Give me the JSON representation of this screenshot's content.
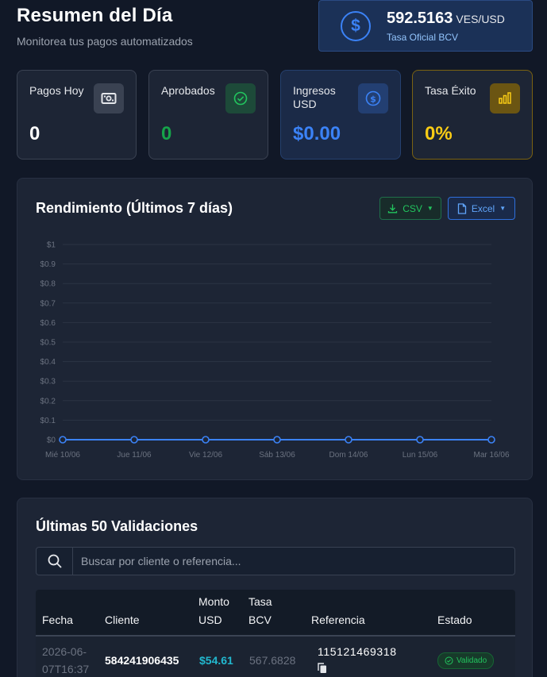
{
  "header": {
    "title": "Resumen del Día",
    "subtitle": "Monitorea tus pagos automatizados"
  },
  "exchange_rate": {
    "value": "592.5163",
    "unit": "VES/USD",
    "label": "Tasa Oficial BCV",
    "icon": "dollar-circle-icon"
  },
  "stats": [
    {
      "label": "Pagos Hoy",
      "value": "0",
      "icon": "money-icon",
      "color": "#ffffff",
      "accent": "#3a4252"
    },
    {
      "label": "Aprobados",
      "value": "0",
      "icon": "check-circle-icon",
      "color": "#16a34a",
      "accent": "#1f6a44"
    },
    {
      "label": "Ingresos USD",
      "value": "$0.00",
      "icon": "dollar-circle-icon",
      "color": "#3b82f6",
      "accent": "#1e3a8a"
    },
    {
      "label": "Tasa Éxito",
      "value": "0%",
      "icon": "bar-chart-icon",
      "color": "#facc15",
      "accent": "#7a6212"
    }
  ],
  "performance": {
    "title": "Rendimiento (Últimos 7 días)",
    "csv_label": "CSV",
    "excel_label": "Excel"
  },
  "chart_data": {
    "type": "line",
    "categories": [
      "Mié 10/06",
      "Jue 11/06",
      "Vie 12/06",
      "Sáb 13/06",
      "Dom 14/06",
      "Lun 15/06",
      "Mar 16/06"
    ],
    "series": [
      {
        "values": [
          0,
          0,
          0,
          0,
          0,
          0,
          0
        ]
      }
    ],
    "y_ticks": [
      "$0",
      "$0.1",
      "$0.2",
      "$0.3",
      "$0.4",
      "$0.5",
      "$0.6",
      "$0.7",
      "$0.8",
      "$0.9",
      "$1"
    ],
    "ylim": [
      0,
      1
    ],
    "grid": true,
    "line_color": "#3b82f6"
  },
  "validations": {
    "title": "Últimas 50 Validaciones",
    "search_placeholder": "Buscar por cliente o referencia...",
    "columns": {
      "fecha": "Fecha",
      "cliente": "Cliente",
      "monto_1": "Monto",
      "monto_2": "USD",
      "tasa_1": "Tasa",
      "tasa_2": "BCV",
      "referencia": "Referencia",
      "estado": "Estado"
    },
    "rows": [
      {
        "fecha_1": "2026-06-",
        "fecha_2": "07T16:37",
        "cliente": "584241906435",
        "monto": "$54.61",
        "tasa": "567.6828",
        "referencia": "115121469318",
        "estado": "Validado"
      }
    ]
  }
}
